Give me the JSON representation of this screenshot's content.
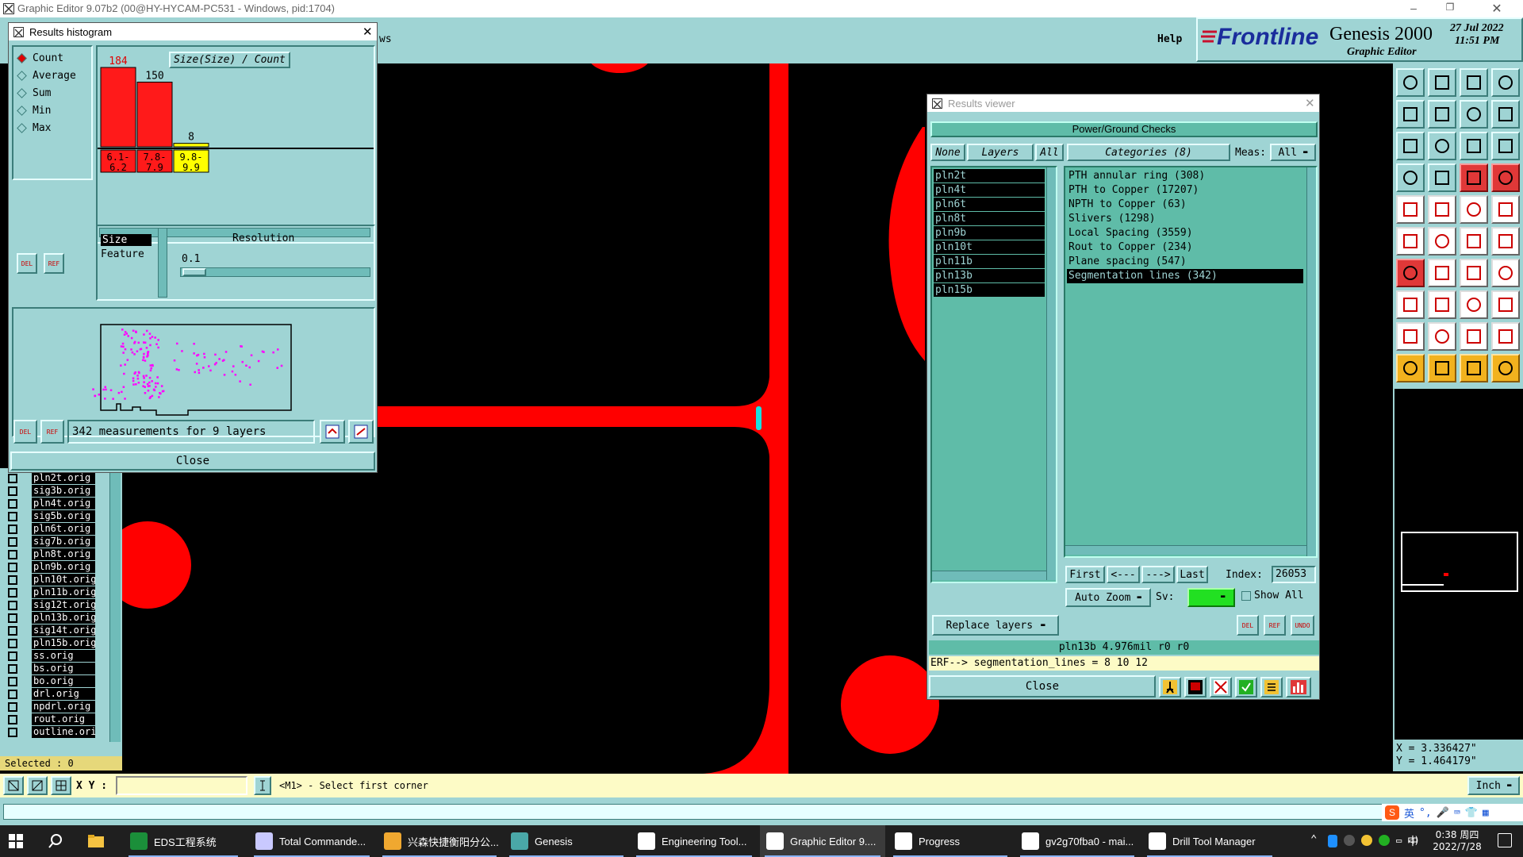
{
  "app": {
    "title": "Graphic Editor 9.07b2 (00@HY-HYCAM-PC531 - Windows, pid:1704)",
    "menu_help": "Help",
    "menu_partial": "ws",
    "brand": "Frontline",
    "product": "Genesis 2000",
    "product_sub": "Graphic Editor",
    "date": "27 Jul 2022",
    "time": "11:51 PM"
  },
  "histogram": {
    "title": "Results histogram",
    "modes": [
      "Count",
      "Average",
      "Sum",
      "Min",
      "Max"
    ],
    "selected_mode": "Count",
    "chart_label": "Size(Size) / Count",
    "bars": [
      {
        "value": "184",
        "range_top": "6.1-",
        "range_bot": "6.2",
        "color": "#ff1a1a"
      },
      {
        "value": "150",
        "range_top": "7.8-",
        "range_bot": "7.9",
        "color": "#ff1a1a"
      },
      {
        "value": "8",
        "range_top": "9.8-",
        "range_bot": "9.9",
        "color": "#ffff00"
      }
    ],
    "bar_counts": [
      184,
      150,
      8
    ],
    "size_label": "Size",
    "feature_label": "Feature",
    "resolution_label": "Resolution",
    "resolution_value": "0.1",
    "del_label": "DEL",
    "ref_label": "REF",
    "summary": "342 measurements for 9 layers",
    "close": "Close"
  },
  "layers_list": [
    "pln2t.orig",
    "sig3b.orig",
    "pln4t.orig",
    "sig5b.orig",
    "pln6t.orig",
    "sig7b.orig",
    "pln8t.orig",
    "pln9b.orig",
    "pln10t.orig",
    "pln11b.orig",
    "sig12t.orig",
    "pln13b.orig",
    "sig14t.orig",
    "pln15b.orig",
    "ss.orig",
    "bs.orig",
    "bo.orig",
    "drl.orig",
    "npdrl.orig",
    "rout.orig",
    "outline.orig"
  ],
  "selected_count": "Selected : 0",
  "results_viewer": {
    "title": "Results viewer",
    "header": "Power/Ground Checks",
    "btn_none": "None",
    "btn_layers": "Layers",
    "btn_all": "All",
    "categories_label": "Categories (8)",
    "meas_label": "Meas:",
    "meas_value": "All",
    "layers": [
      "pln2t",
      "pln4t",
      "pln6t",
      "pln8t",
      "pln9b",
      "pln10t",
      "pln11b",
      "pln13b",
      "pln15b"
    ],
    "categories": [
      "PTH annular ring (308)",
      "PTH to Copper (17207)",
      "NPTH to Copper (63)",
      "Slivers (1298)",
      "Local Spacing (3559)",
      "Rout to Copper (234)",
      "Plane spacing (547)",
      "Segmentation lines (342)"
    ],
    "selected_category": 7,
    "first": "First",
    "prev": "<---",
    "next": "--->",
    "last": "Last",
    "index_label": "Index:",
    "index_value": "26053",
    "auto_zoom": "Auto Zoom",
    "sv_label": "Sv:",
    "show_all": "Show All",
    "replace_layers": "Replace layers",
    "status": "pln13b 4.976mil  r0  r0",
    "erf": "ERF--> segmentation_lines = 8 10 12",
    "close": "Close",
    "del": "DEL",
    "ref": "REF",
    "undo": "UNDO"
  },
  "coords": {
    "x": "X = 3.336427\"",
    "y": "Y = 1.464179\"",
    "units": "Inch"
  },
  "command_bar": {
    "xy_label": "X Y :",
    "prompt": "<M1> - Select first corner"
  },
  "ime": {
    "lang": "英"
  },
  "taskbar": {
    "items": [
      {
        "label": "EDS工程系统",
        "icon_color": "#1b8f3a"
      },
      {
        "label": "Total Commande...",
        "icon_color": "#c9c9ff"
      },
      {
        "label": "兴森快捷衡阳分公...",
        "icon_color": "#f0a830"
      },
      {
        "label": "Genesis",
        "icon_color": "#4aa8a8"
      },
      {
        "label": "Engineering Tool...",
        "icon_color": "#ffffff"
      },
      {
        "label": "Graphic Editor 9....",
        "icon_color": "#ffffff"
      },
      {
        "label": "Progress",
        "icon_color": "#ffffff"
      },
      {
        "label": "gv2g70fba0 - mai...",
        "icon_color": "#ffffff"
      },
      {
        "label": "Drill Tool Manager",
        "icon_color": "#ffffff"
      }
    ],
    "clock_time": "0:38 周四",
    "clock_date": "2022/7/28",
    "ime_char": "中"
  }
}
